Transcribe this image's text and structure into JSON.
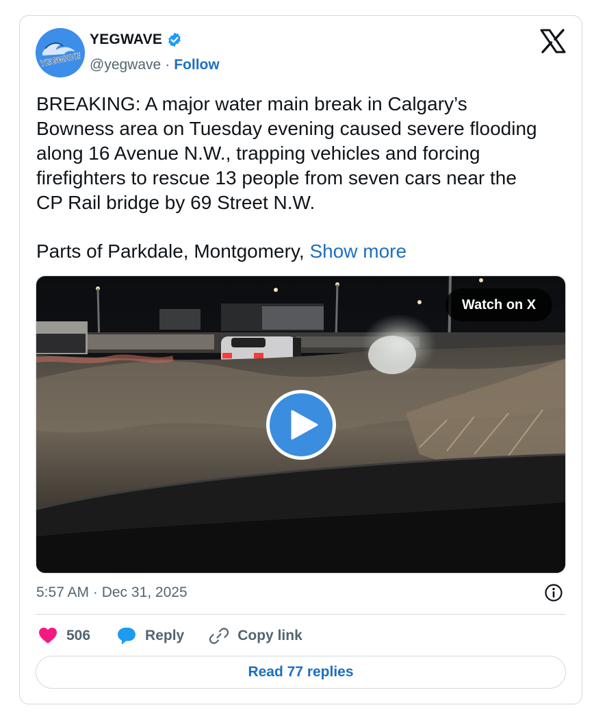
{
  "author": {
    "name": "YEGWAVE",
    "avatar_text": "YEGWAVE",
    "handle": "@yegwave",
    "separator": "·",
    "follow_label": "Follow",
    "verified_icon": "verified-badge-icon",
    "verified_color": "#1d9bf0"
  },
  "brand_icon": "x-logo-icon",
  "tweet": {
    "text": "BREAKING: A major water main break in Calgary’s\nBowness area on Tuesday evening caused severe flooding\nalong 16 Avenue N.W., trapping vehicles and forcing\nfirefighters to rescue 13 people from seven cars near the\nCP Rail bridge by 69 Street N.W.",
    "truncated_text": "Parts of Parkdale, Montgomery, ",
    "show_more_label": "Show more"
  },
  "media": {
    "watch_label": "Watch on X",
    "play_icon": "play-icon",
    "play_color": "#3b8ddf"
  },
  "meta": {
    "timestamp": "5:57 AM · Dec 31, 2025",
    "info_icon": "info-icon"
  },
  "actions": {
    "like_count": "506",
    "like_color": "#f91880",
    "reply_label": "Reply",
    "reply_color": "#1d9bf0",
    "copy_link_label": "Copy link"
  },
  "read_replies_label": "Read 77 replies",
  "colors": {
    "link": "#1d6fc0",
    "muted": "#536471",
    "border": "#cfd9de",
    "text": "#0f1419"
  }
}
